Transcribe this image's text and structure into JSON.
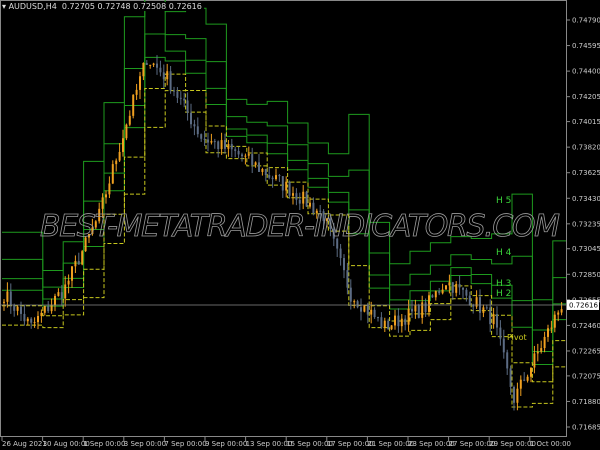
{
  "header": {
    "symbol": "AUDUSD,H4",
    "ohlc": "0.72705 0.72748 0.72508 0.72616"
  },
  "price_axis": [
    "0.74790",
    "0.74595",
    "0.74400",
    "0.74205",
    "0.74015",
    "0.73820",
    "0.73625",
    "0.73430",
    "0.73235",
    "0.73045",
    "0.72850",
    "0.72655",
    "0.72460",
    "0.72265",
    "0.72075",
    "0.71880",
    "0.71685"
  ],
  "current_price": "0.72616",
  "time_axis": [
    "26 Aug 2021",
    "30 Aug 00:00",
    "1 Sep 00:00",
    "3 Sep 00:00",
    "7 Sep 00:00",
    "9 Sep 00:00",
    "13 Sep 00:00",
    "15 Sep 00:00",
    "17 Sep 00:00",
    "21 Sep 00:00",
    "23 Sep 00:00",
    "27 Sep 00:00",
    "29 Sep 00:00",
    "1 Oct 00:00"
  ],
  "level_labels": {
    "h5": "H 5",
    "h4": "H 4",
    "h3": "H 3",
    "h2": "H 2",
    "pivot": "Pivot"
  },
  "watermark": "BEST-METATRADER-INDICATORS.COM",
  "colors": {
    "bull": "#f0a020",
    "bear": "#5c6c84",
    "level": "#1e9a1e",
    "pivot": "#c8c81e",
    "label": "#3ad43a"
  },
  "price_path": [
    [
      0,
      0.727
    ],
    [
      8,
      0.7245
    ],
    [
      18,
      0.7275
    ],
    [
      28,
      0.733
    ],
    [
      36,
      0.74
    ],
    [
      42,
      0.745
    ],
    [
      48,
      0.7435
    ],
    [
      58,
      0.739
    ],
    [
      70,
      0.7375
    ],
    [
      84,
      0.735
    ],
    [
      94,
      0.733
    ],
    [
      102,
      0.727
    ],
    [
      112,
      0.7245
    ],
    [
      124,
      0.726
    ],
    [
      130,
      0.728
    ],
    [
      138,
      0.7265
    ],
    [
      144,
      0.725
    ],
    [
      150,
      0.719
    ],
    [
      156,
      0.722
    ],
    [
      164,
      0.7262
    ]
  ]
}
